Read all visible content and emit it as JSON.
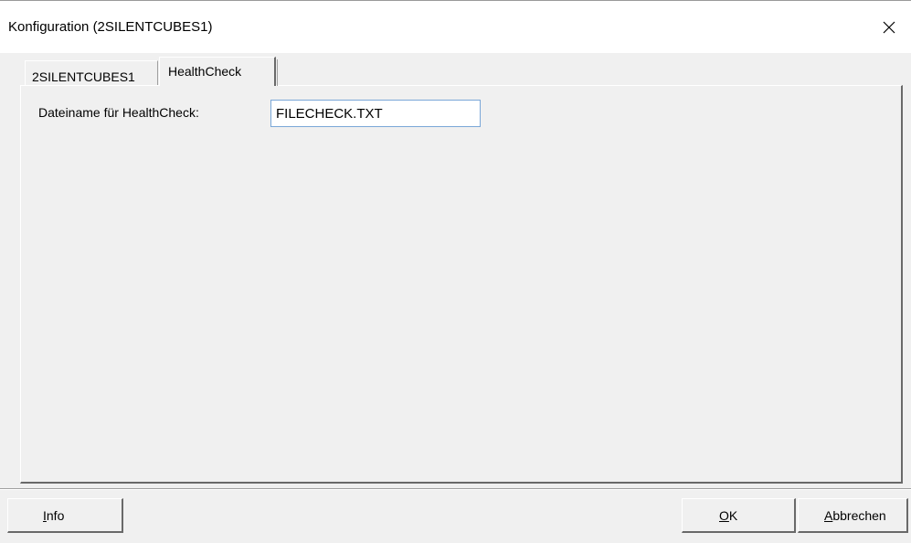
{
  "window": {
    "title": "Konfiguration (2SILENTCUBES1)",
    "close_icon": "close-x-icon"
  },
  "tabs": [
    {
      "label": "2SILENTCUBES1",
      "active": false
    },
    {
      "label": "HealthCheck",
      "active": true
    }
  ],
  "healthcheck": {
    "filename_label": "Dateiname für HealthCheck:",
    "filename_value": "FILECHECK.TXT"
  },
  "buttons": {
    "info": {
      "mnemonic": "I",
      "rest": "nfo"
    },
    "ok": {
      "mnemonic": "O",
      "rest": "K"
    },
    "cancel": {
      "mnemonic": "A",
      "rest": "bbrechen"
    }
  },
  "colors": {
    "face": "#f0f0f0",
    "titlebar": "#ffffff",
    "input_border": "#7aa7d8",
    "shadow": "#696969"
  }
}
